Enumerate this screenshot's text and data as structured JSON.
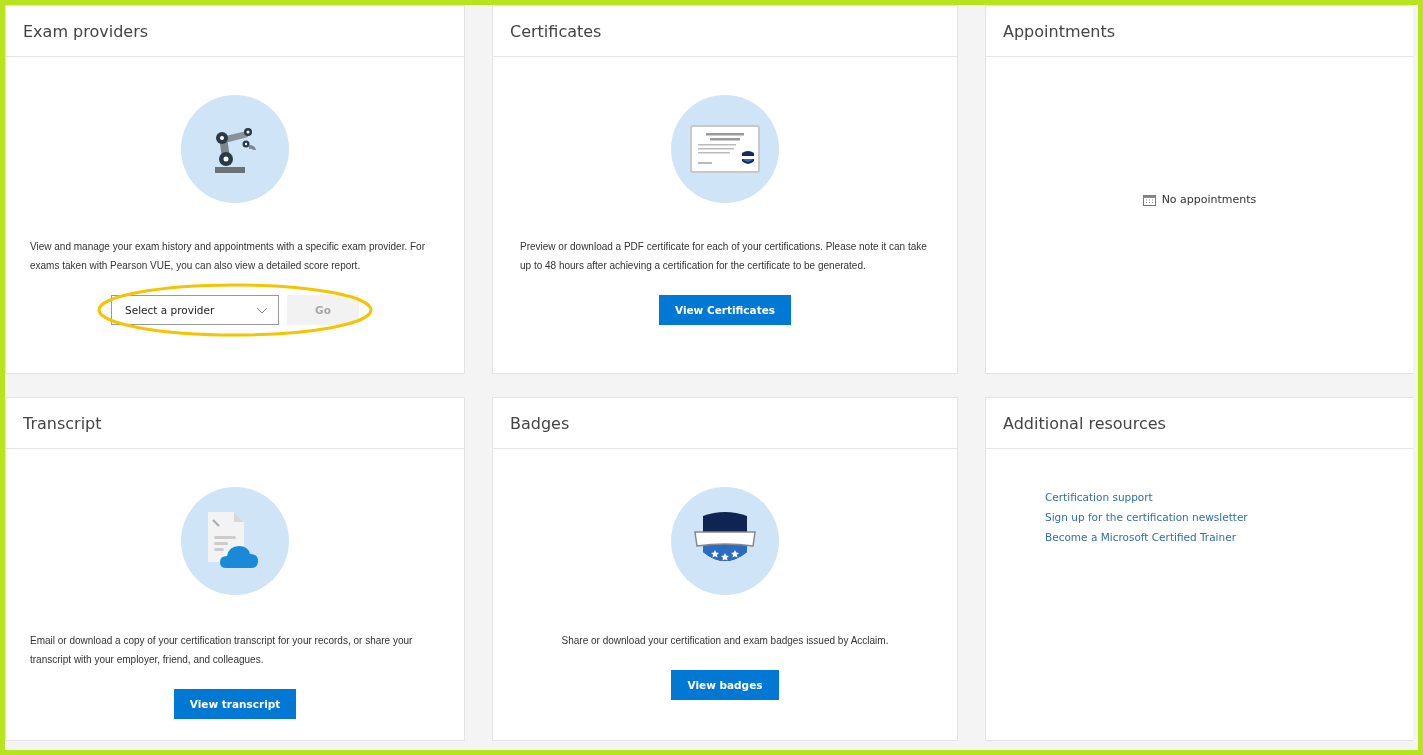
{
  "cards": [
    {
      "kind": "illustrated",
      "title": "Exam providers",
      "illustration": {
        "kind": "robot"
      },
      "description": "View and manage your exam history and appointments with a specific exam provider. For exams taken with Pearson VUE, you can also view a detailed score report.",
      "select": {
        "placeholder": "Select a provider"
      },
      "button": {
        "label": "Go",
        "disabled": true
      },
      "highlighted": true
    },
    {
      "kind": "illustrated",
      "title": "Certificates",
      "illustration": {
        "kind": "certificate"
      },
      "description": "Preview or download a PDF certificate for each of your certifications. Please note it can take up to 48 hours after achieving a certification for the certificate to be generated.",
      "button": {
        "label": "View Certificates",
        "disabled": false
      },
      "highlighted": false
    },
    {
      "kind": "empty",
      "title": "Appointments",
      "message": "No appointments"
    },
    {
      "kind": "illustrated",
      "title": "Transcript",
      "illustration": {
        "kind": "transcript"
      },
      "description": "Email or download a copy of your certification transcript for your records, or share your transcript with your employer, friend, and colleagues.",
      "button": {
        "label": "View transcript",
        "disabled": false
      },
      "highlighted": false
    },
    {
      "kind": "illustrated",
      "title": "Badges",
      "illustration": {
        "kind": "badge"
      },
      "description": "Share or download your certification and exam badges issued by Acclaim.",
      "button": {
        "label": "View badges",
        "disabled": false
      },
      "highlighted": false
    },
    {
      "kind": "links",
      "title": "Additional resources",
      "links": [
        "Certification support",
        "Sign up for the certification newsletter",
        "Become a Microsoft Certified Trainer"
      ]
    }
  ]
}
